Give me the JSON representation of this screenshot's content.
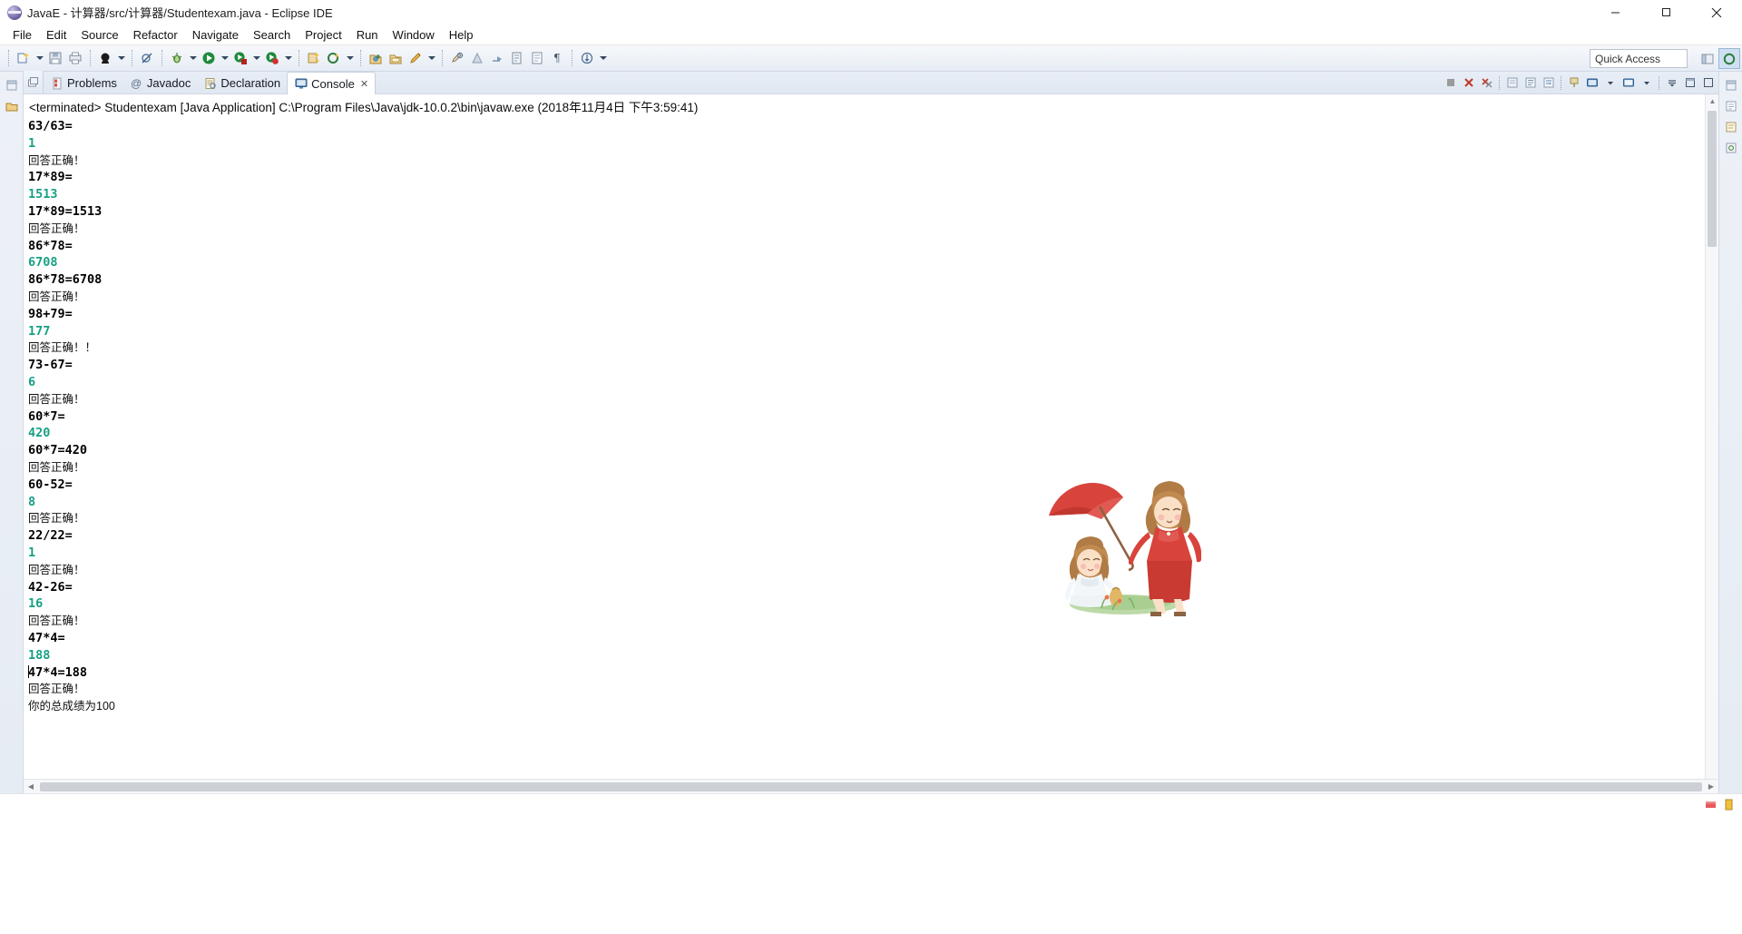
{
  "window": {
    "title": "JavaE - 计算器/src/计算器/Studentexam.java - Eclipse IDE",
    "app_icon": "eclipse-logo-icon",
    "minimize_label": "Minimize",
    "maximize_label": "Maximize",
    "close_label": "Close"
  },
  "menubar": {
    "items": [
      {
        "label": "File"
      },
      {
        "label": "Edit"
      },
      {
        "label": "Source"
      },
      {
        "label": "Refactor"
      },
      {
        "label": "Navigate"
      },
      {
        "label": "Search"
      },
      {
        "label": "Project"
      },
      {
        "label": "Run"
      },
      {
        "label": "Window"
      },
      {
        "label": "Help"
      }
    ]
  },
  "toolbar": {
    "quick_access_text": "Quick Access",
    "buttons": [
      {
        "name": "new-wizard-icon",
        "has_arrow": true
      },
      {
        "name": "save-icon",
        "has_arrow": false
      },
      {
        "name": "print-icon",
        "has_arrow": false
      },
      {
        "name": "toggle-mark-occurrences-icon",
        "has_arrow": true
      },
      {
        "name": "skip-breakpoints-icon",
        "has_arrow": false
      },
      {
        "name": "debug-bug-icon",
        "has_arrow": true
      },
      {
        "name": "run-icon",
        "has_arrow": true
      },
      {
        "name": "run-coverage-icon",
        "has_arrow": true
      },
      {
        "name": "external-tools-icon",
        "has_arrow": true
      },
      {
        "name": "new-java-package-icon",
        "has_arrow": false
      },
      {
        "name": "new-java-class-icon",
        "has_arrow": true
      },
      {
        "name": "open-type-icon",
        "has_arrow": false
      },
      {
        "name": "search-folder-icon",
        "has_arrow": false
      },
      {
        "name": "annotation-icon",
        "has_arrow": true
      },
      {
        "name": "previous-annotation-icon",
        "has_arrow": false
      },
      {
        "name": "next-annotation-icon",
        "has_arrow": false
      },
      {
        "name": "last-edit-location-icon",
        "has_arrow": false
      },
      {
        "name": "back-icon",
        "has_arrow": false
      },
      {
        "name": "forward-icon",
        "has_arrow": false
      },
      {
        "name": "pilcrow-icon",
        "has_arrow": false
      },
      {
        "name": "download-icon",
        "has_arrow": true
      }
    ],
    "perspective_java_label": "Java",
    "perspective_open_label": "Open Perspective"
  },
  "view_tabs": {
    "restore_label": "Restore",
    "items": [
      {
        "label": "Problems",
        "icon": "problems-icon",
        "active": false
      },
      {
        "label": "Javadoc",
        "icon": "javadoc-at-icon",
        "active": false
      },
      {
        "label": "Declaration",
        "icon": "declaration-icon",
        "active": false
      },
      {
        "label": "Console",
        "icon": "console-icon",
        "active": true,
        "closeable": true
      }
    ],
    "toolbar_buttons": [
      {
        "name": "terminate-icon"
      },
      {
        "name": "remove-launch-icon"
      },
      {
        "name": "remove-all-terminated-icon"
      },
      {
        "name": "clear-console-icon"
      },
      {
        "name": "scroll-lock-icon"
      },
      {
        "name": "word-wrap-icon"
      },
      {
        "name": "pin-console-icon"
      },
      {
        "name": "display-selected-console-icon"
      },
      {
        "name": "open-console-icon"
      },
      {
        "name": "view-menu-icon"
      },
      {
        "name": "minimize-view-icon"
      },
      {
        "name": "maximize-view-icon"
      }
    ]
  },
  "console": {
    "terminated_line": "<terminated> Studentexam [Java Application] C:\\Program Files\\Java\\jdk-10.0.2\\bin\\javaw.exe (2018年11月4日 下午3:59:41)",
    "output_lines": [
      {
        "text": "63/63=",
        "style": "q"
      },
      {
        "text": "1",
        "style": "a"
      },
      {
        "text": "回答正确！",
        "style": "msg"
      },
      {
        "text": "17*89=",
        "style": "q"
      },
      {
        "text": "1513",
        "style": "a"
      },
      {
        "text": "17*89=1513",
        "style": "q"
      },
      {
        "text": "回答正确！",
        "style": "msg"
      },
      {
        "text": "86*78=",
        "style": "q"
      },
      {
        "text": "6708",
        "style": "a"
      },
      {
        "text": "86*78=6708",
        "style": "q"
      },
      {
        "text": "回答正确！",
        "style": "msg"
      },
      {
        "text": "98+79=",
        "style": "q"
      },
      {
        "text": "177",
        "style": "a"
      },
      {
        "text": "回答正确！！",
        "style": "msg"
      },
      {
        "text": "73-67=",
        "style": "q"
      },
      {
        "text": "6",
        "style": "a"
      },
      {
        "text": "回答正确！",
        "style": "msg"
      },
      {
        "text": "60*7=",
        "style": "q"
      },
      {
        "text": "420",
        "style": "a"
      },
      {
        "text": "60*7=420",
        "style": "q"
      },
      {
        "text": "回答正确！",
        "style": "msg"
      },
      {
        "text": "60-52=",
        "style": "q"
      },
      {
        "text": "8",
        "style": "a"
      },
      {
        "text": "回答正确！",
        "style": "msg"
      },
      {
        "text": "22/22=",
        "style": "q"
      },
      {
        "text": "1",
        "style": "a"
      },
      {
        "text": "回答正确！",
        "style": "msg"
      },
      {
        "text": "42-26=",
        "style": "q"
      },
      {
        "text": "16",
        "style": "a"
      },
      {
        "text": "回答正确！",
        "style": "msg"
      },
      {
        "text": "47*4=",
        "style": "q"
      },
      {
        "text": "188",
        "style": "a"
      },
      {
        "text": "47*4=188",
        "style": "q",
        "caret": true
      },
      {
        "text": "回答正确！",
        "style": "msg"
      },
      {
        "text": "你的总成绩为100",
        "style": "msg"
      }
    ],
    "illustration_name": "two-girls-with-umbrella-illustration"
  },
  "statusbar": {
    "icons": [
      "writable-indicator-icon",
      "progress-indicator-icon"
    ]
  },
  "colors": {
    "answer_green": "#16a085",
    "question_black": "#000000",
    "toolbar_bg": "#eef2f8",
    "tab_active_bg": "#ffffff",
    "accent_blue": "#cde8ff"
  }
}
